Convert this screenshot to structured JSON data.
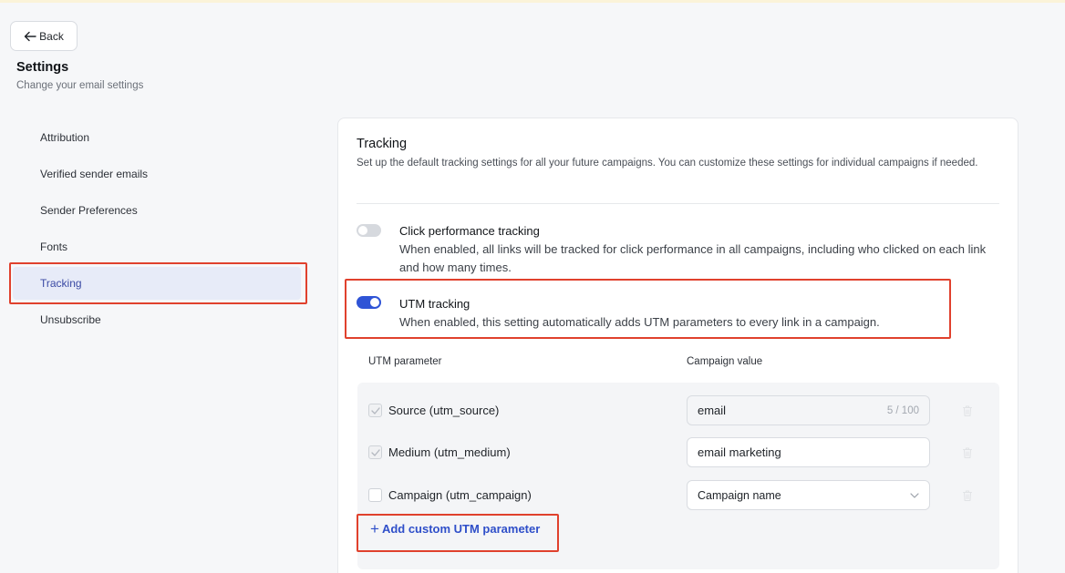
{
  "back_label": "Back",
  "page": {
    "title": "Settings",
    "subtitle": "Change your email settings"
  },
  "sidebar": {
    "items": [
      {
        "label": "Attribution"
      },
      {
        "label": "Verified sender emails"
      },
      {
        "label": "Sender Preferences"
      },
      {
        "label": "Fonts"
      },
      {
        "label": "Tracking"
      },
      {
        "label": "Unsubscribe"
      }
    ],
    "active": "Tracking"
  },
  "tracking": {
    "title": "Tracking",
    "description": "Set up the default tracking settings for all your future campaigns. You can customize these settings for individual campaigns if needed.",
    "options": [
      {
        "title": "Click performance tracking",
        "description": "When enabled, all links will be tracked for click performance in all campaigns, including who clicked on each link and how many times.",
        "enabled": false
      },
      {
        "title": "UTM tracking",
        "description": "When enabled, this setting automatically adds UTM parameters to every link in a campaign.",
        "enabled": true
      }
    ]
  },
  "utm_table": {
    "headers": {
      "parameter": "UTM parameter",
      "value": "Campaign value"
    },
    "rows": [
      {
        "label": "Source (utm_source)",
        "checked": true,
        "value": "email",
        "counter": "5 / 100"
      },
      {
        "label": "Medium (utm_medium)",
        "checked": true,
        "value": "email marketing"
      },
      {
        "label": "Campaign (utm_campaign)",
        "checked": false,
        "value": "Campaign name"
      }
    ],
    "add_label": "Add custom UTM parameter"
  },
  "colors": {
    "accent": "#2f54d6",
    "link": "#2f4fc9",
    "active_nav_bg": "#e7ebf8",
    "highlight": "#e0412d"
  },
  "icons": {
    "back": "arrow-left-icon",
    "check": "check-icon",
    "chevron": "chevron-down-icon",
    "delete": "trash-icon",
    "add": "plus-icon"
  }
}
